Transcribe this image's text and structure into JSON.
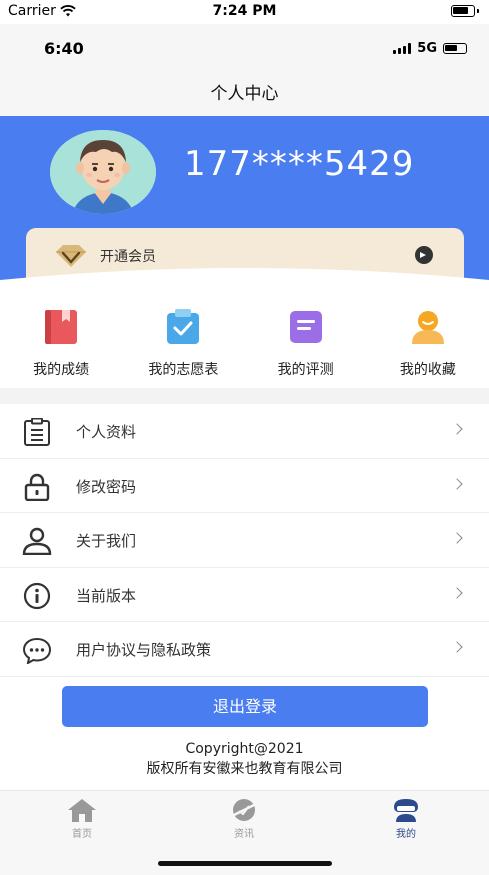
{
  "outer_status": {
    "carrier": "Carrier",
    "time": "7:24 PM",
    "wifi_icon": "wifi-icon",
    "battery_icon": "battery-icon"
  },
  "inner_status": {
    "time": "6:40",
    "network": "5G"
  },
  "navbar": {
    "title": "个人中心"
  },
  "profile": {
    "phone": "177****5429",
    "vip_label": "开通会员"
  },
  "quick_actions": [
    {
      "label": "我的成绩",
      "icon": "grade-book-icon",
      "color": "#e8585c"
    },
    {
      "label": "我的志愿表",
      "icon": "checklist-icon",
      "color": "#4aa8e8"
    },
    {
      "label": "我的评测",
      "icon": "assessment-icon",
      "color": "#9b6ee8"
    },
    {
      "label": "我的收藏",
      "icon": "favorite-user-icon",
      "color": "#f5a623"
    }
  ],
  "menu": [
    {
      "label": "个人资料",
      "icon": "clipboard-icon"
    },
    {
      "label": "修改密码",
      "icon": "lock-icon"
    },
    {
      "label": "关于我们",
      "icon": "person-icon"
    },
    {
      "label": "当前版本",
      "icon": "info-icon"
    },
    {
      "label": "用户协议与隐私政策",
      "icon": "chat-bubble-icon"
    }
  ],
  "logout_label": "退出登录",
  "copyright": {
    "line1": "Copyright@2021",
    "line2": "版权所有安徽来也教育有限公司"
  },
  "tabbar": [
    {
      "label": "首页",
      "icon": "home-icon",
      "active": false
    },
    {
      "label": "资讯",
      "icon": "news-icon",
      "active": false
    },
    {
      "label": "我的",
      "icon": "profile-icon",
      "active": true
    }
  ],
  "colors": {
    "primary": "#4a7df0",
    "vip_card": "#f4ead7",
    "tab_active": "#2c4a8c",
    "tab_inactive": "#999999"
  }
}
